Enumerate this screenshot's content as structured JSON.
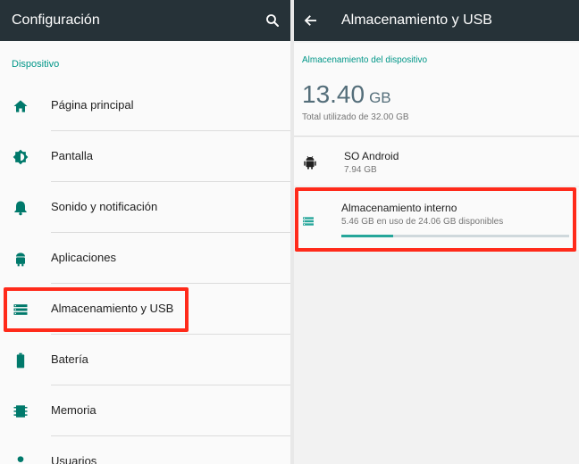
{
  "colors": {
    "appbar": "#263238",
    "accent": "#009688",
    "highlight": "#ff2a1a",
    "progress": "#26a69a"
  },
  "settings": {
    "title": "Configuración",
    "search_icon": "search-icon",
    "section_header": "Dispositivo",
    "items": [
      {
        "label": "Página principal",
        "icon": "home-icon"
      },
      {
        "label": "Pantalla",
        "icon": "brightness-icon"
      },
      {
        "label": "Sonido y notificación",
        "icon": "bell-icon"
      },
      {
        "label": "Aplicaciones",
        "icon": "android-icon"
      },
      {
        "label": "Almacenamiento y USB",
        "icon": "storage-icon"
      },
      {
        "label": "Batería",
        "icon": "battery-icon"
      },
      {
        "label": "Memoria",
        "icon": "memory-icon"
      },
      {
        "label": "Usuarios",
        "icon": "person-icon"
      }
    ]
  },
  "storage": {
    "title": "Almacenamiento y USB",
    "back_icon": "back-arrow-icon",
    "section_header": "Almacenamiento del dispositivo",
    "used_value": "13.40",
    "used_unit": "GB",
    "total_text": "Total utilizado de 32.00 GB",
    "android": {
      "name": "SO Android",
      "size": "7.94 GB",
      "icon": "android-icon"
    },
    "internal": {
      "name": "Almacenamiento interno",
      "usage": "5.46 GB en uso de 24.06 GB disponibles",
      "used_fraction": 0.227,
      "icon": "storage-icon"
    }
  }
}
